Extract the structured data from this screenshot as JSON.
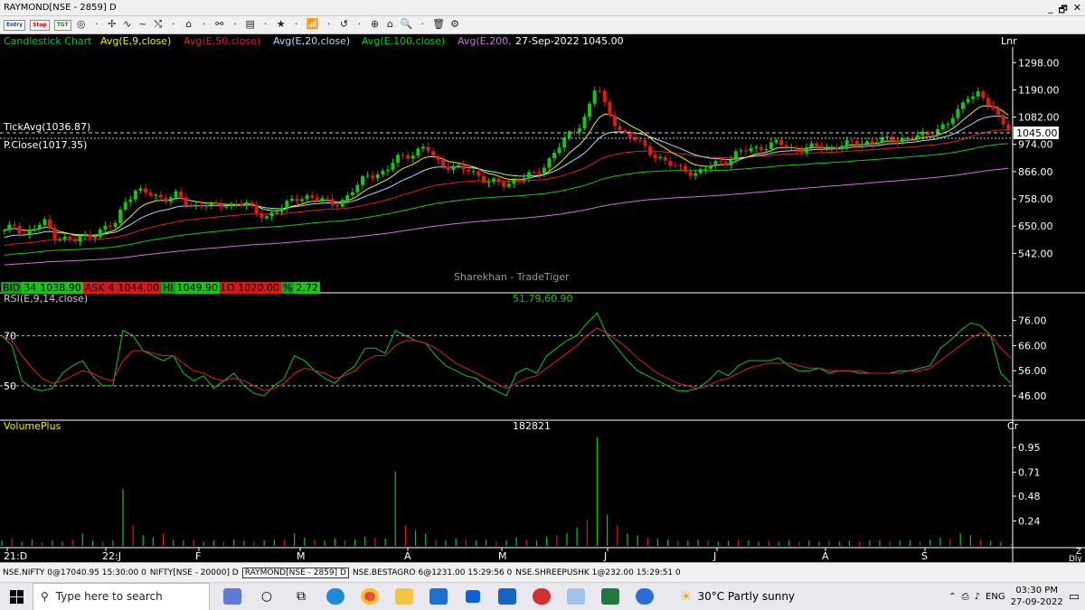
{
  "window": {
    "title": "RAYMOND[NSE - 2859] D",
    "buttons": [
      "_",
      "🗗",
      "✕"
    ]
  },
  "toolbar": {
    "order_buttons": [
      "Entry",
      "Stop",
      "TGT"
    ],
    "icons": [
      "◎",
      "·",
      "✢",
      "∿",
      "~",
      "⤭",
      "·",
      "⌂",
      "·",
      "⚯",
      "·",
      "▤",
      "·",
      "★",
      "·",
      "📶",
      "·",
      "↺",
      "·",
      "⊕",
      "⌂",
      "🔍",
      "·",
      "🗑",
      "⚙"
    ]
  },
  "chart_header": {
    "chart_type": "Candlestick Chart",
    "ma9": "Avg(E,9,close)",
    "ma50": "Avg(E,50,close)",
    "ma20": "Avg(E,20,close)",
    "ma100": "Avg(E,100,close)",
    "ma200": "Avg(E,200,",
    "date_price": "27-Sep-2022 1045.00",
    "scale": "Lnr"
  },
  "price_labels": {
    "tick_avg": "TickAvg(1036.87)",
    "p_close": "P.Close(1017.35)",
    "last_price": "1045.00",
    "watermark": "Sharekhan - TradeTiger"
  },
  "quote_bar": {
    "bid_label": "BID",
    "bid_qty": "34",
    "bid_price": "1038.90",
    "ask_label": "ASK",
    "ask_qty": "4",
    "ask_price": "1044.00",
    "hi_label": "HI",
    "hi_price": "1049.90",
    "lo_label": "LO",
    "lo_price": "1020.00",
    "pct_label": "%",
    "pct_value": "2.72"
  },
  "rsi_header": {
    "label": "RSI(E,9,14,close)",
    "values": "51.79,60.90"
  },
  "volume_header": {
    "label": "VolumePlus",
    "value": "182821",
    "right_tag": "Cr"
  },
  "bottom_corner": {
    "top": "Z",
    "bottom": "Dly"
  },
  "chart_data": [
    {
      "type": "candlestick",
      "title": "Candlestick Chart",
      "y_ticks": [
        1298.0,
        1190.0,
        1082.0,
        974.0,
        866.0,
        758.0,
        650.0,
        542.0
      ],
      "ylim": [
        450,
        1360
      ],
      "x_labels": [
        "21:D",
        "22:J",
        "F",
        "M",
        "A",
        "M",
        "J",
        "J",
        "A",
        "S"
      ],
      "last_close": 1045.0,
      "tick_avg": 1036.87,
      "prev_close": 1017.35,
      "close_path": [
        626,
        655,
        620,
        640,
        665,
        615,
        600,
        590,
        610,
        620,
        640,
        655,
        750,
        790,
        780,
        770,
        760,
        775,
        740,
        730,
        745,
        720,
        735,
        740,
        745,
        700,
        690,
        710,
        730,
        760,
        770,
        760,
        745,
        740,
        760,
        800,
        850,
        860,
        860,
        920,
        930,
        945,
        960,
        910,
        890,
        880,
        870,
        860,
        830,
        820,
        810,
        840,
        850,
        850,
        900,
        960,
        1000,
        1030,
        1100,
        1220,
        1100,
        1050,
        1010,
        990,
        950,
        930,
        900,
        880,
        870,
        860,
        880,
        900,
        910,
        940,
        950,
        960,
        970,
        980,
        960,
        955,
        960,
        965,
        960,
        970,
        975,
        980,
        985,
        990,
        990,
        995,
        1000,
        1005,
        1010,
        1040,
        1060,
        1100,
        1170,
        1180,
        1130,
        1080,
        1045
      ]
    },
    {
      "type": "line",
      "title": "RSI(E,9,14,close)",
      "y_ticks": [
        76.0,
        66.0,
        56.0,
        46.0
      ],
      "ylim": [
        37,
        82
      ],
      "ref_lines": [
        70,
        50
      ],
      "series": [
        {
          "name": "RSI",
          "values": [
            70,
            66,
            52,
            49,
            48,
            49,
            55,
            58,
            60,
            54,
            50,
            50,
            72,
            70,
            64,
            62,
            60,
            62,
            55,
            52,
            54,
            49,
            52,
            55,
            50,
            47,
            46,
            50,
            53,
            62,
            60,
            56,
            53,
            51,
            55,
            58,
            65,
            65,
            63,
            72,
            70,
            68,
            67,
            62,
            58,
            56,
            54,
            53,
            50,
            48,
            46,
            55,
            57,
            55,
            62,
            65,
            68,
            70,
            75,
            79,
            70,
            65,
            60,
            56,
            54,
            52,
            50,
            48,
            48,
            49,
            52,
            56,
            54,
            58,
            60,
            60,
            60,
            61,
            58,
            56,
            56,
            57,
            55,
            56,
            56,
            55,
            55,
            55,
            55,
            56,
            56,
            57,
            58,
            65,
            68,
            72,
            75,
            74,
            70,
            55,
            51
          ]
        },
        {
          "name": "Avg",
          "values": [
            70,
            68,
            62,
            57,
            53,
            51,
            52,
            54,
            56,
            55,
            53,
            52,
            60,
            64,
            64,
            63,
            62,
            62,
            59,
            56,
            55,
            53,
            52,
            53,
            52,
            50,
            48,
            49,
            51,
            55,
            57,
            56,
            55,
            53,
            54,
            56,
            60,
            62,
            62,
            66,
            68,
            68,
            67,
            65,
            62,
            59,
            57,
            55,
            53,
            51,
            49,
            51,
            53,
            54,
            57,
            60,
            63,
            66,
            70,
            73,
            71,
            68,
            65,
            61,
            58,
            55,
            53,
            51,
            50,
            49,
            50,
            52,
            53,
            55,
            57,
            58,
            59,
            59,
            59,
            58,
            57,
            57,
            56,
            56,
            56,
            56,
            55,
            55,
            55,
            55,
            56,
            56,
            57,
            60,
            63,
            66,
            69,
            71,
            70,
            65,
            61
          ]
        }
      ]
    },
    {
      "type": "bar",
      "title": "VolumePlus",
      "y_ticks": [
        0.95,
        0.71,
        0.48,
        0.24
      ],
      "ylim": [
        0,
        1.1
      ],
      "values": [
        0.05,
        0.08,
        0.04,
        0.06,
        0.03,
        0.05,
        0.04,
        0.06,
        0.12,
        0.05,
        0.04,
        0.05,
        0.55,
        0.2,
        0.1,
        0.08,
        0.12,
        0.06,
        0.05,
        0.06,
        0.04,
        0.05,
        0.04,
        0.06,
        0.05,
        0.04,
        0.05,
        0.06,
        0.05,
        0.12,
        0.08,
        0.06,
        0.05,
        0.07,
        0.05,
        0.06,
        0.09,
        0.08,
        0.07,
        0.72,
        0.2,
        0.15,
        0.12,
        0.06,
        0.05,
        0.07,
        0.06,
        0.05,
        0.06,
        0.04,
        0.05,
        0.08,
        0.06,
        0.05,
        0.09,
        0.1,
        0.12,
        0.18,
        0.25,
        1.05,
        0.3,
        0.2,
        0.12,
        0.1,
        0.08,
        0.07,
        0.06,
        0.05,
        0.05,
        0.06,
        0.05,
        0.04,
        0.05,
        0.06,
        0.05,
        0.04,
        0.05,
        0.04,
        0.05,
        0.04,
        0.05,
        0.04,
        0.05,
        0.04,
        0.05,
        0.04,
        0.05,
        0.05,
        0.04,
        0.05,
        0.05,
        0.04,
        0.06,
        0.08,
        0.07,
        0.12,
        0.1,
        0.06,
        0.05,
        0.04,
        0.02
      ]
    }
  ],
  "status_bar": {
    "items": [
      "NSE.NIFTY 0@17040.95 15:30:00 0",
      "NIFTY[NSE - 20000] D",
      "RAYMOND[NSE - 2859] D",
      "NSE.BESTAGRO 6@1231.00 15:29:56 0",
      "NSE.SHREEPUSHK 1@232.00 15:29:51 0"
    ],
    "active_index": 2
  },
  "taskbar": {
    "search_placeholder": "Type here to search",
    "weather": "30°C  Partly sunny",
    "lang": "ENG",
    "time": "03:30 PM",
    "date": "27-09-2022"
  },
  "colors": {
    "up": "#17c417",
    "down": "#e01818",
    "ma9": "#f0f000",
    "ma20": "#9fe0ff",
    "ma50": "#e02020",
    "ma100": "#19c519",
    "ma200": "#d070e0"
  }
}
